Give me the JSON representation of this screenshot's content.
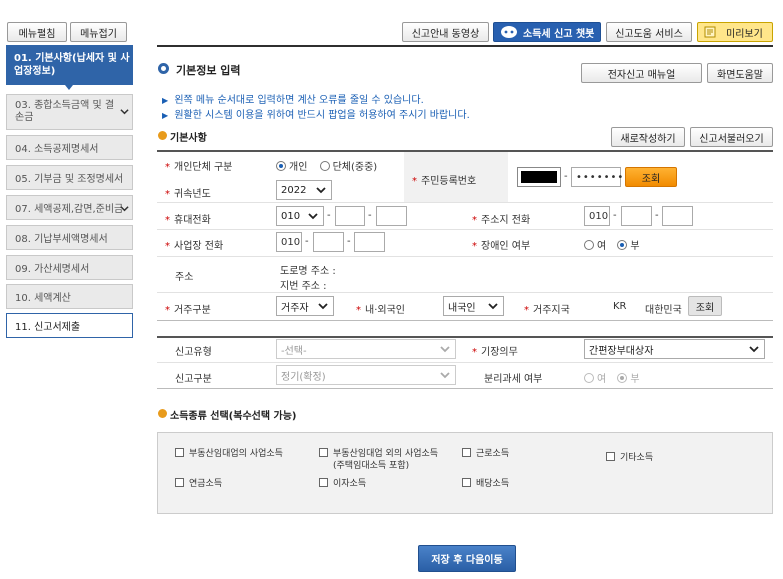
{
  "sidebar": {
    "expand_btn": "메뉴펼침",
    "collapse_btn": "메뉴접기",
    "active_item": "01. 기본사항(납세자 및 사업장정보)",
    "items": [
      "03. 종합소득금액 및 결손금",
      "04. 소득공제명세서",
      "05. 기부금 및 조정명세서",
      "07. 세액공제,감면,준비금",
      "08. 기납부세액명세서",
      "09. 가산세명세서",
      "10. 세액계산",
      "11. 신고서제출"
    ]
  },
  "topbar": {
    "video": "신고안내 동영상",
    "chatbot": "소득세 신고 챗봇",
    "help_service": "신고도움 서비스",
    "preview": "미리보기"
  },
  "page": {
    "title": "기본정보 입력",
    "manual_btn": "전자신고 매뉴얼",
    "screen_help_btn": "화면도움말",
    "notice1": "왼쪽 메뉴 순서대로 입력하면 계산 오류를 줄일 수 있습니다.",
    "notice2": "원활한 시스템 이용을 위하여 반드시 팝업을 허용하여 주시기 바랍니다."
  },
  "basic": {
    "section_title": "기본사항",
    "new_btn": "새로작성하기",
    "load_btn": "신고서불러오기",
    "type_label": "개인단체 구분",
    "type_personal": "개인",
    "type_group": "단체(중중)",
    "year_label": "귀속년도",
    "year_value": "2022",
    "rrn_label": "주민등록번호",
    "rrn_dash": "-",
    "rrn_back": "•••••••",
    "lookup_btn": "조회",
    "mobile_label": "휴대전화",
    "mobile_prefix": "010",
    "addr_phone_label": "주소지 전화",
    "addr_phone_prefix": "010",
    "biz_phone_label": "사업장 전화",
    "biz_phone_prefix": "010",
    "disabled_label": "장애인 여부",
    "yes": "여",
    "no": "부",
    "address_label": "주소",
    "road_address": "도로명 주소 :",
    "lot_address": "지번 주소 :",
    "residence_label": "거주구분",
    "residence_value": "거주자",
    "nationality_label": "내·외국인",
    "nationality_value": "내국인",
    "region_label": "거주지국",
    "region_code": "KR",
    "region_name": "대한민국",
    "region_btn": "조회",
    "report_type_label": "신고유형",
    "report_type_value": "-선택-",
    "bookkeeping_label": "기장의무",
    "bookkeeping_value": "간편장부대상자",
    "report_class_label": "신고구분",
    "report_class_value": "정기(확정)",
    "separate_tax_label": "분리과세 여부",
    "separate_yes": "여",
    "separate_no": "부"
  },
  "income": {
    "section_title": "소득종류 선택(복수선택 가능)",
    "options": [
      "부동산임대업의 사업소득",
      "부동산임대업 외의 사업소득",
      "(주택임대소득 포함)",
      "근로소득",
      "기타소득",
      "연금소득",
      "이자소득",
      "배당소득"
    ]
  },
  "footer": {
    "save_next": "저장 후 다음이동"
  }
}
